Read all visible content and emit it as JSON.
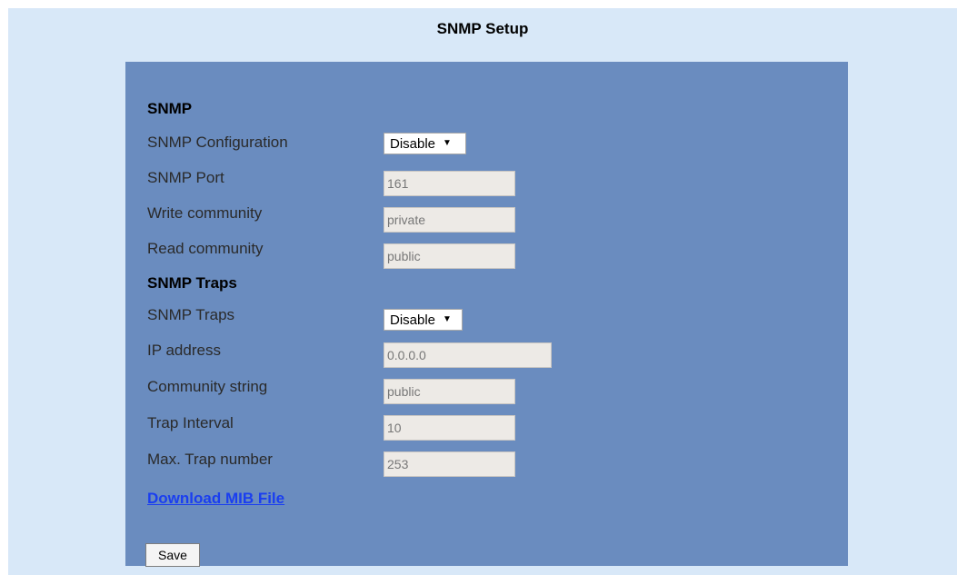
{
  "page": {
    "title": "SNMP Setup"
  },
  "snmp": {
    "section_title": "SNMP",
    "configuration": {
      "label": "SNMP Configuration",
      "value": "Disable"
    },
    "port": {
      "label": "SNMP Port",
      "value": "161"
    },
    "write_community": {
      "label": "Write community",
      "value": "private"
    },
    "read_community": {
      "label": "Read community",
      "value": "public"
    }
  },
  "traps": {
    "section_title": "SNMP Traps",
    "traps": {
      "label": "SNMP Traps",
      "value": "Disable"
    },
    "ip_address": {
      "label": "IP address",
      "value": "0.0.0.0"
    },
    "community_string": {
      "label": "Community string",
      "value": "public"
    },
    "trap_interval": {
      "label": "Trap Interval",
      "value": "10"
    },
    "max_trap_number": {
      "label": "Max. Trap number",
      "value": "253"
    }
  },
  "download_link": "Download MIB File",
  "save_label": "Save",
  "colors": {
    "background": "#d8e8f8",
    "panel": "#6a8cbf",
    "link": "#1a3ef0"
  }
}
